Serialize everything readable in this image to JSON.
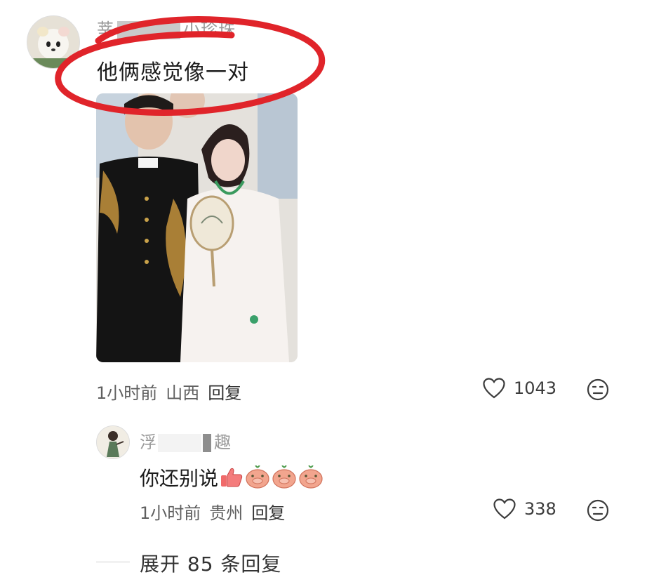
{
  "comment": {
    "username_start": "莘",
    "username_end": "小珍珠",
    "text": "他俩感觉像一对",
    "time": "1小时前",
    "location": "山西",
    "reply_label": "回复",
    "likes": "1043"
  },
  "reply": {
    "username_start": "浮",
    "username_end": "趣",
    "text": "你还别说",
    "time": "1小时前",
    "location": "贵州",
    "reply_label": "回复",
    "likes": "338"
  },
  "expand": {
    "label": "展开 85 条回复"
  },
  "icons": {
    "like": "heart-outline-icon",
    "dislike": "neutral-face-icon",
    "emoji_1": "thumbs-up-emoji",
    "emoji_2": "pig-face-emoji"
  },
  "colors": {
    "highlight_circle": "#e0242a",
    "meta_text": "#5f5f5f",
    "username": "#9a9a9a"
  }
}
